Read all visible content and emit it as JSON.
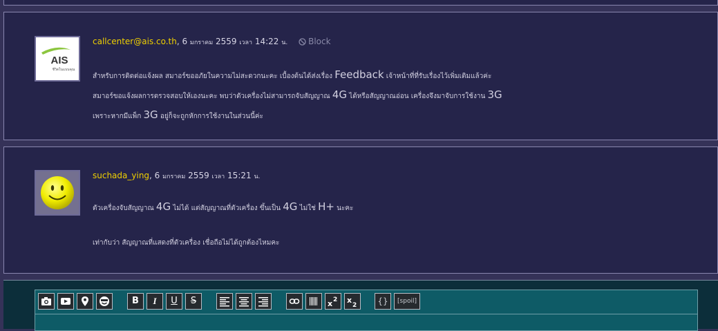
{
  "posts": [
    {
      "author": "callcenter@ais.co.th",
      "date_prefix": ", 6 ",
      "month": "มกราคม",
      "year": " 2559 ",
      "time_word": "เวลา",
      "time": " 14:22 ",
      "suffix": "น.",
      "block_label": "Block",
      "avatar_brand": "AIS",
      "avatar_tagline": "ชีวิตในแบบคุณ",
      "lines": [
        [
          "สำหรับการติดต่อแจ้งผล สมาอร์ขออภัยในความไม่สะดวกนะคะ เบื้องต้นได้ส่งเรื่อง ",
          "Feedback",
          " เจ้าหน้าที่ที่รับเรื่องไว้เพิ่มเติมแล้วค่ะ"
        ],
        [
          "สมาอร์ขอแจ้งผลการตรวจสอบให้เองนะคะ  พบว่าตัวเครื่องไม่สามารถจับสัญญาณ ",
          "4G",
          " ได้หรือสัญญาณอ่อน เครื่องจึงมาจับการใช้งาน ",
          "3G"
        ],
        [
          "เพราะหากมีแพ็ก ",
          "3G",
          " อยู่ก็จะถูกหักการใช้งานในส่วนนี้ค่ะ"
        ]
      ]
    },
    {
      "author": "suchada_ying",
      "date_prefix": ", 6 ",
      "month": "มกราคม",
      "year": " 2559 ",
      "time_word": "เวลา",
      "time": " 15:21 ",
      "suffix": "น.",
      "lines": [
        [
          "ตัวเครื่องจับสัญญาณ ",
          "4G",
          " ไม่ได้ แต่สัญญาณที่ตัวเครื่อง ขึ้นเป็น ",
          "4G",
          " ไม่ใช่ ",
          "H+",
          " นะคะ"
        ],
        [
          "เท่ากับว่า สัญญาณที่แสดงที่ตัวเครื่อง เชื่อถือไม่ได้ถูกต้องไหมคะ"
        ]
      ]
    }
  ],
  "toolbar": {
    "bold": "B",
    "italic": "I",
    "underline": "U",
    "strike": "S",
    "code": "{}",
    "spoil": "[spoil]"
  },
  "colors": {
    "page_bg": "#353258",
    "panel_bg": "#25244a",
    "author": "#f0d000",
    "editor_bg": "#0e5b66",
    "button_bg": "#262a2e"
  },
  "icons": [
    "camera-icon",
    "youtube-icon",
    "map-pin-icon",
    "emoji-icon",
    "align-left-icon",
    "align-center-icon",
    "align-right-icon",
    "link-icon",
    "page-break-icon",
    "superscript-icon",
    "subscript-icon"
  ]
}
